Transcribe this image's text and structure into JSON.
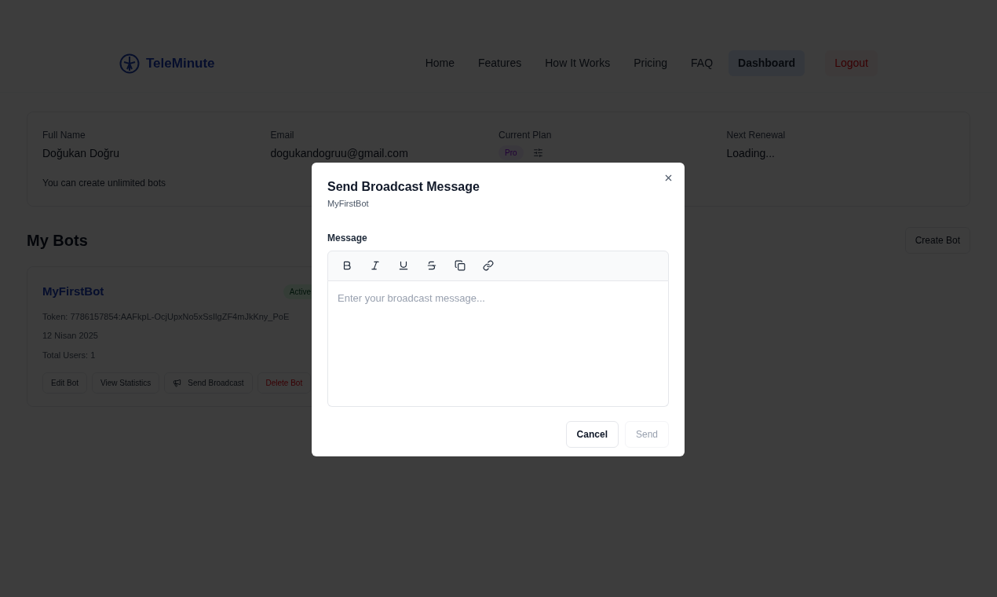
{
  "brand": {
    "name": "TeleMinute"
  },
  "nav": [
    {
      "label": "Home",
      "selected": false,
      "kind": "link"
    },
    {
      "label": "Features",
      "selected": false,
      "kind": "link"
    },
    {
      "label": "How It Works",
      "selected": false,
      "kind": "link"
    },
    {
      "label": "Pricing",
      "selected": false,
      "kind": "link"
    },
    {
      "label": "FAQ",
      "selected": false,
      "kind": "link"
    },
    {
      "label": "Dashboard",
      "selected": true,
      "kind": "link"
    },
    {
      "label": "Logout",
      "selected": false,
      "kind": "danger"
    }
  ],
  "profile": {
    "fields": [
      {
        "label": "Full Name",
        "value": "Doğukan Doğru",
        "kind": "text"
      },
      {
        "label": "Email",
        "value": "dogukandogruu@gmail.com",
        "kind": "text"
      },
      {
        "label": "Current Plan",
        "value": "Pro",
        "kind": "plan"
      },
      {
        "label": "Next Renewal",
        "value": "Loading...",
        "kind": "text"
      }
    ],
    "note": "You can create unlimited bots"
  },
  "bots_section": {
    "title": "My Bots",
    "create_button": "Create Bot"
  },
  "bots": [
    {
      "name": "MyFirstBot",
      "status": "Active",
      "token": "Token: 7786157854:AAFkpL-OcjUpxNo5xSsIlgZF4mJkKny_PoE",
      "date": "12 Nisan 2025",
      "users": "Total Users: 1",
      "actions": [
        {
          "label": "Edit Bot",
          "kind": "plain"
        },
        {
          "label": "View Statistics",
          "kind": "plain"
        },
        {
          "label": "Send Broadcast",
          "kind": "broadcast"
        },
        {
          "label": "Delete Bot",
          "kind": "danger"
        }
      ]
    }
  ],
  "dialog": {
    "title": "Send Broadcast Message",
    "subtitle": "MyFirstBot",
    "field_label": "Message",
    "placeholder": "Enter your broadcast message...",
    "buttons": [
      {
        "label": "Cancel",
        "disabled": false
      },
      {
        "label": "Send",
        "disabled": true
      }
    ]
  }
}
